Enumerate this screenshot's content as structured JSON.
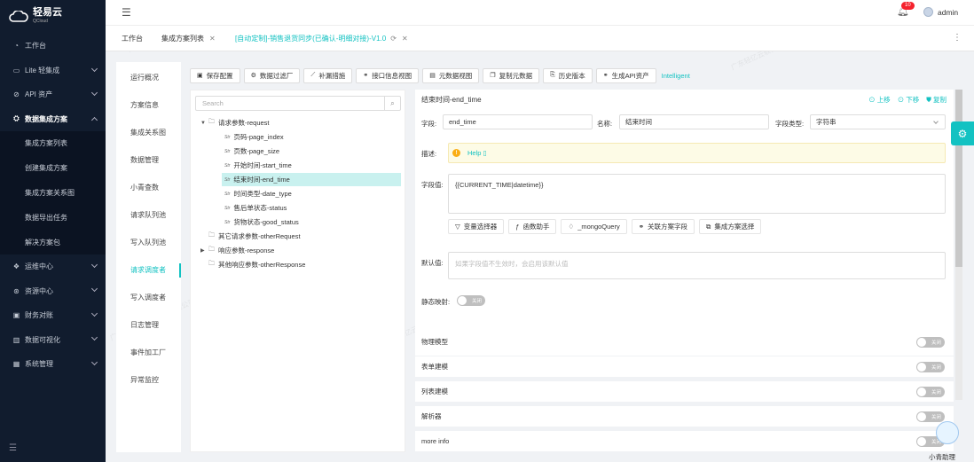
{
  "app": {
    "brand": "轻易云",
    "brand_sub": "QCloud",
    "user": "admin",
    "notification_count": "10",
    "accent": "#13c2c2"
  },
  "sidebar": {
    "items": [
      {
        "label": "工作台",
        "icon": "dashboard-icon"
      },
      {
        "label": "Lite 轻集成",
        "icon": "lite-icon"
      },
      {
        "label": "API 资产",
        "icon": "api-icon"
      },
      {
        "label": "数据集成方案",
        "icon": "integration-icon"
      },
      {
        "label": "运维中心",
        "icon": "ops-icon"
      },
      {
        "label": "资源中心",
        "icon": "resource-icon"
      },
      {
        "label": "财务对账",
        "icon": "finance-icon"
      },
      {
        "label": "数据可视化",
        "icon": "chart-icon"
      },
      {
        "label": "系统管理",
        "icon": "settings-icon"
      }
    ],
    "subitems": [
      "集成方案列表",
      "创建集成方案",
      "集成方案关系图",
      "数据导出任务",
      "解决方案包"
    ]
  },
  "tabs": [
    {
      "label": "工作台"
    },
    {
      "label": "集成方案列表"
    },
    {
      "label": "[自动定制]-销售退货同步(已确认-明细对接)-V1.0"
    }
  ],
  "secnav": [
    "运行概况",
    "方案信息",
    "集成关系图",
    "数据管理",
    "小青查数",
    "请求队列池",
    "写入队列池",
    "请求调度者",
    "写入调度者",
    "日志管理",
    "事件加工厂",
    "异常监控"
  ],
  "toolbar": {
    "buttons": [
      "保存配置",
      "数据过滤厂",
      "补漏措施",
      "接口信息视图",
      "元数据视图",
      "复制元数据",
      "历史版本",
      "生成API资产"
    ],
    "link": "Intelligent"
  },
  "tree": {
    "search_placeholder": "Search",
    "nodes": [
      "请求参数-request",
      "页码-page_index",
      "页数-page_size",
      "开始时间-start_time",
      "结束时间-end_time",
      "时间类型-date_type",
      "售后单状态-status",
      "货物状态-good_status",
      "其它请求参数-otherRequest",
      "响应参数-response",
      "其他响应参数-otherResponse"
    ]
  },
  "detail": {
    "title": "结束时间-end_time",
    "actions": [
      "上移",
      "下移",
      "复制"
    ],
    "field_label": "字段:",
    "field_value": "end_time",
    "name_label": "名称:",
    "name_value": "结束时间",
    "type_label": "字段类型:",
    "type_value": "字符串",
    "desc_label": "描述:",
    "help": "Help",
    "value_label": "字段值:",
    "value": "{{CURRENT_TIME|datetime}}",
    "buttons": [
      "变量选择器",
      "函数助手",
      "_mongoQuery",
      "关联方案字段",
      "集成方案选择"
    ],
    "default_label": "默认值:",
    "default_placeholder": "如果字段值不生效时，会启用该默认值",
    "static_label": "静态映射:",
    "toggle_off": "关闭"
  },
  "rows": [
    "物理模型",
    "表单建模",
    "列表建模",
    "解析器",
    "more info"
  ],
  "assistant": "小青助理",
  "watermark": "广东轻亿云软件科技有限公司"
}
